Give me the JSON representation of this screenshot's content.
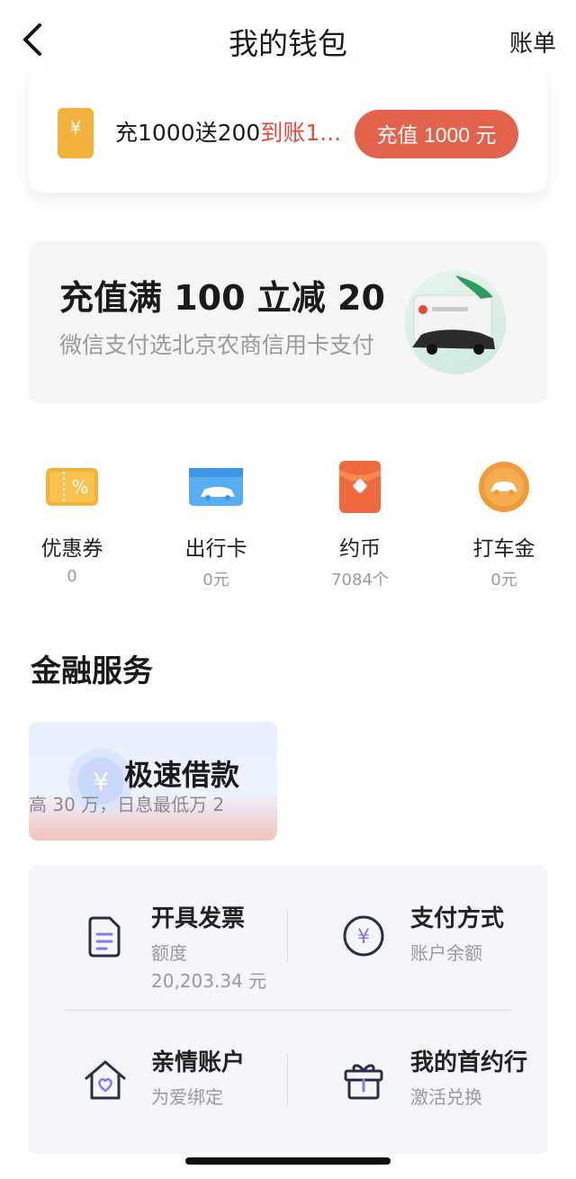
{
  "header": {
    "title": "我的钱包",
    "bill_label": "账单"
  },
  "recharge": {
    "icon_symbol": "¥",
    "text_main": "充1000送200",
    "text_highlight": "到账1...",
    "button_label": "充值 1000 元"
  },
  "promo": {
    "title": "充值满 100 立减 20",
    "subtitle": "微信支付选北京农商信用卡支付"
  },
  "entries": [
    {
      "label": "优惠券",
      "value": "0"
    },
    {
      "label": "出行卡",
      "value": "0元"
    },
    {
      "label": "约币",
      "value": "7084个"
    },
    {
      "label": "打车金",
      "value": "0元"
    }
  ],
  "finance": {
    "section_title": "金融服务",
    "loan_title": "极速借款",
    "loan_subtitle": "高 30 万，日息最低万 2"
  },
  "services": [
    {
      "title": "开具发票",
      "sub": "额度",
      "sub2": "20,203.34 元"
    },
    {
      "title": "支付方式",
      "sub": "账户余额"
    },
    {
      "title": "亲情账户",
      "sub": "为爱绑定"
    },
    {
      "title": "我的首约行",
      "sub": "激活兑换"
    }
  ],
  "colors": {
    "accent": "#e2624b",
    "highlight": "#e24c3b",
    "icon_stroke": "#2b2e48"
  }
}
